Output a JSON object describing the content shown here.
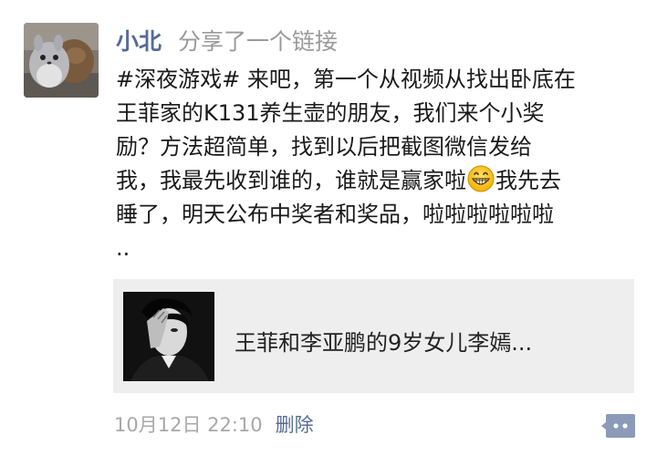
{
  "post": {
    "author": "小北",
    "action": "分享了一个链接",
    "avatar_icon": "plush-toy-avatar",
    "text_lines": [
      "#深夜游戏# 来吧，第一个从视频从找出卧底在",
      "王菲家的K131养生壶的朋友，我们来个小奖",
      "励？方法超简单，找到以后把截图微信发给",
      "我，我最先收到谁的，谁就是赢家啦",
      "我先去",
      "睡了，明天公布中奖者和奖品，啦啦啦啦啦啦",
      ".."
    ],
    "emoji": "grinning-face-emoji"
  },
  "link_card": {
    "title": "王菲和李亚鹏的9岁女儿李嫣...",
    "thumbnail_icon": "portrait-photo"
  },
  "meta": {
    "timestamp": "10月12日 22:10",
    "delete_label": "删除",
    "comment_icon": "comment-bubble-icon"
  },
  "colors": {
    "name_blue": "#576b95",
    "gray_text": "#9a9a9a",
    "card_bg": "#eeeeee",
    "comment_btn": "#8a9ab8"
  }
}
